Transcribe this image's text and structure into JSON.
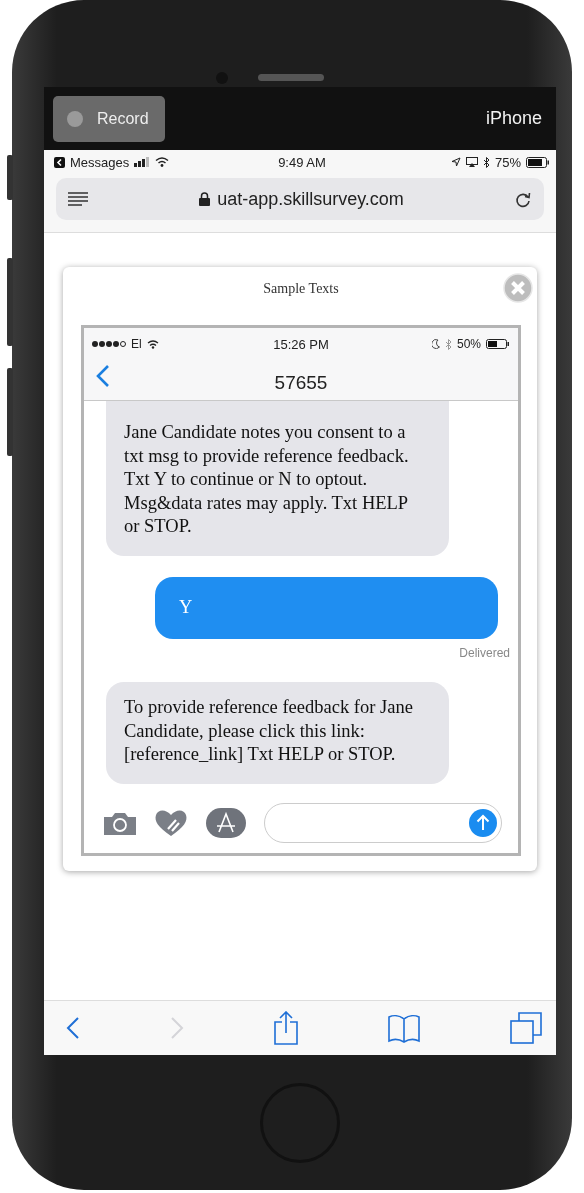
{
  "recorder": {
    "record_label": "Record",
    "recording": false,
    "device_name": "iPhone"
  },
  "status_bar": {
    "back_app": "Messages",
    "time": "9:49 AM",
    "battery": "75%"
  },
  "address_bar": {
    "url": "uat-app.skillsurvey.com"
  },
  "modal": {
    "title": "Sample Texts",
    "phone": {
      "status_bar": {
        "carrier": "El",
        "time": "15:26 PM",
        "battery": "50%"
      },
      "contact": "57655",
      "messages": [
        {
          "kind": "incoming",
          "text": "Jane Candidate notes you consent to a txt msg to provide reference feedback. Txt Y to continue or N to optout. Msg&data rates may apply. Txt HELP or STOP."
        },
        {
          "kind": "outgoing",
          "text": "Y",
          "status": "Delivered"
        },
        {
          "kind": "incoming",
          "text": "To provide reference feedback for Jane Candidate, please click this link: [reference_link] Txt HELP or STOP."
        }
      ]
    }
  },
  "toolbar": {
    "buttons": [
      {
        "kind": "back",
        "disabled": false
      },
      {
        "kind": "forward",
        "disabled": true
      },
      {
        "kind": "share",
        "disabled": false
      },
      {
        "kind": "bookmarks",
        "disabled": false
      },
      {
        "kind": "tabs",
        "disabled": false
      }
    ]
  }
}
